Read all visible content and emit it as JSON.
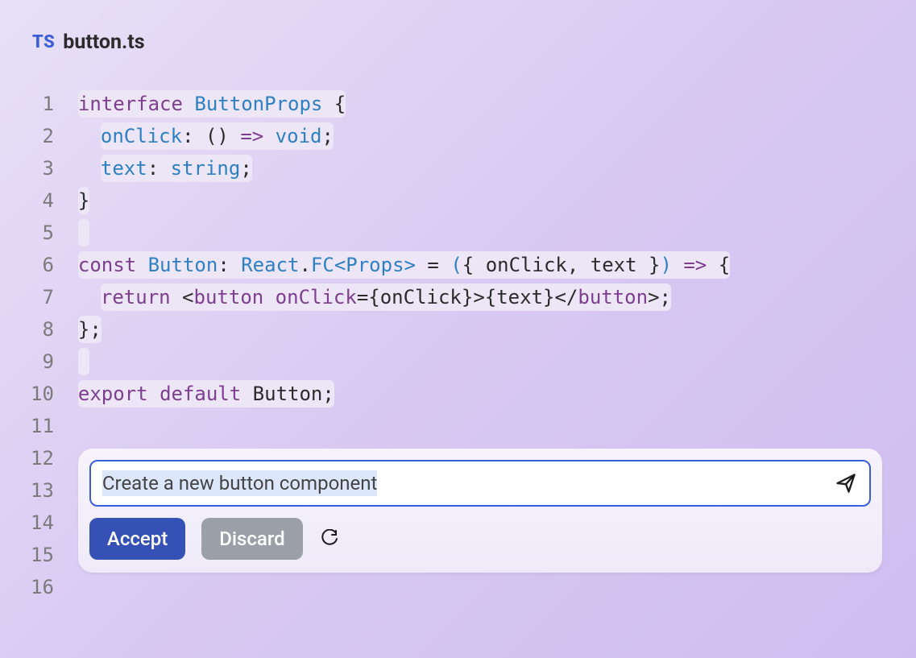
{
  "header": {
    "lang_badge": "TS",
    "filename": "button.ts"
  },
  "gutter": {
    "lines": [
      "1",
      "2",
      "3",
      "4",
      "5",
      "6",
      "7",
      "8",
      "9",
      "10",
      "11",
      "12",
      "13",
      "14",
      "15",
      "16"
    ]
  },
  "code": {
    "line1": {
      "t1": "interface",
      "t2": " ButtonProps ",
      "t3": "{"
    },
    "line2": {
      "t1": "onClick",
      "t2": ": () ",
      "t3": "=>",
      "t4": " ",
      "t5": "void",
      "t6": ";"
    },
    "line3": {
      "t1": "text",
      "t2": ": ",
      "t3": "string",
      "t4": ";"
    },
    "line4": {
      "t1": "}"
    },
    "line5": {
      "t1": " "
    },
    "line6": {
      "t1": "const",
      "t2": " Button",
      "t3": ": ",
      "t4": "React",
      "t5": ".",
      "t6": "FC",
      "t7": "<",
      "t8": "Props",
      "t9": ">",
      "t10": " = ",
      "t11": "(",
      "t12": "{ onClick, text }",
      "t13": ")",
      "t14": " ",
      "t15": "=>",
      "t16": " {"
    },
    "line7": {
      "t1": "return",
      "t2": " <",
      "t3": "button",
      "t4": " ",
      "t5": "onClick",
      "t6": "={onClick}>{text}</",
      "t7": "button",
      "t8": ">;"
    },
    "line8": {
      "t1": "};"
    },
    "line9_blank": {
      "t1": " "
    },
    "line9": {
      "t1": "export",
      "t2": " ",
      "t3": "default",
      "t4": " Button;"
    }
  },
  "prompt": {
    "value": "Create a new button component",
    "accept_label": "Accept",
    "discard_label": "Discard"
  },
  "icons": {
    "send": "send-icon",
    "refresh": "refresh-icon"
  }
}
